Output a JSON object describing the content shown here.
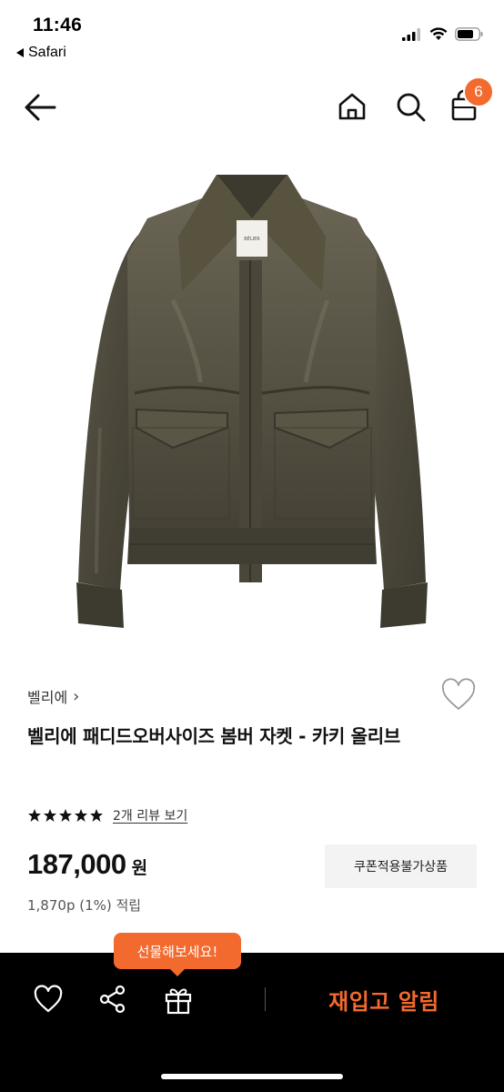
{
  "status_bar": {
    "time": "11:46",
    "back_app": "Safari",
    "icons": [
      "cellular-signal-icon",
      "wifi-icon",
      "battery-icon"
    ]
  },
  "nav": {
    "cart_count": "6",
    "icons": [
      "back-arrow-icon",
      "home-icon",
      "search-icon",
      "shopping-bag-icon"
    ]
  },
  "product": {
    "image_description_icon": "khaki-bomber-jacket-image",
    "brand": "벨리에",
    "brand_chevron": "›",
    "name": "벨리에 패디드오버사이즈 봄버 자켓 - 카키 올리브",
    "rating_stars": 5,
    "review_link": "2개 리뷰 보기",
    "price": "187,000",
    "price_unit": "원",
    "coupon_tag": "쿠폰적용불가상품",
    "points": "1,870p (1%) 적립"
  },
  "bottom_bar": {
    "gift_tooltip": "선물해보세요!",
    "restock_label": "재입고 알림",
    "icons": [
      "heart-icon",
      "share-icon",
      "gift-icon"
    ]
  },
  "colors": {
    "accent": "#f26a2e",
    "bottom_bar_bg": "#000000",
    "jacket": "#4f4b3f"
  }
}
